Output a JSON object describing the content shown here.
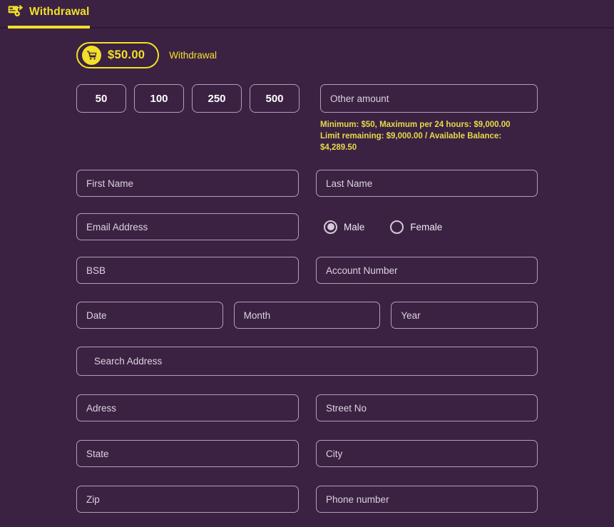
{
  "header": {
    "title": "Withdrawal",
    "icon": "withdrawal-card-icon",
    "accent_color": "#f2e029",
    "background_color": "#3b2242"
  },
  "summary": {
    "icon": "shopping-cart-icon",
    "amount": "$50.00",
    "label": "Withdrawal"
  },
  "amounts": {
    "options": [
      "50",
      "100",
      "250",
      "500"
    ],
    "other_placeholder": "Other amount",
    "other_value": "",
    "limits": [
      "Minimum: $50, Maximum per 24 hours: $9,000.00",
      "Limit remaining: $9,000.00 / Available Balance: $4,289.50"
    ]
  },
  "form": {
    "first_name": {
      "placeholder": "First Name",
      "value": ""
    },
    "last_name": {
      "placeholder": "Last Name",
      "value": ""
    },
    "email": {
      "placeholder": "Email Address",
      "value": ""
    },
    "bsb": {
      "placeholder": "BSB",
      "value": ""
    },
    "account_number": {
      "placeholder": "Account Number",
      "value": ""
    },
    "date": {
      "placeholder": "Date",
      "value": ""
    },
    "month": {
      "placeholder": "Month",
      "value": ""
    },
    "year": {
      "placeholder": "Year",
      "value": ""
    },
    "search_address": {
      "placeholder": "Search Address",
      "value": ""
    },
    "address": {
      "placeholder": "Adress",
      "value": ""
    },
    "street_no": {
      "placeholder": "Street No",
      "value": ""
    },
    "state": {
      "placeholder": "State",
      "value": ""
    },
    "city": {
      "placeholder": "City",
      "value": ""
    },
    "zip": {
      "placeholder": "Zip",
      "value": ""
    },
    "phone": {
      "placeholder": "Phone number",
      "value": ""
    }
  },
  "gender": {
    "options": [
      {
        "label": "Male",
        "selected": true
      },
      {
        "label": "Female",
        "selected": false
      }
    ]
  }
}
